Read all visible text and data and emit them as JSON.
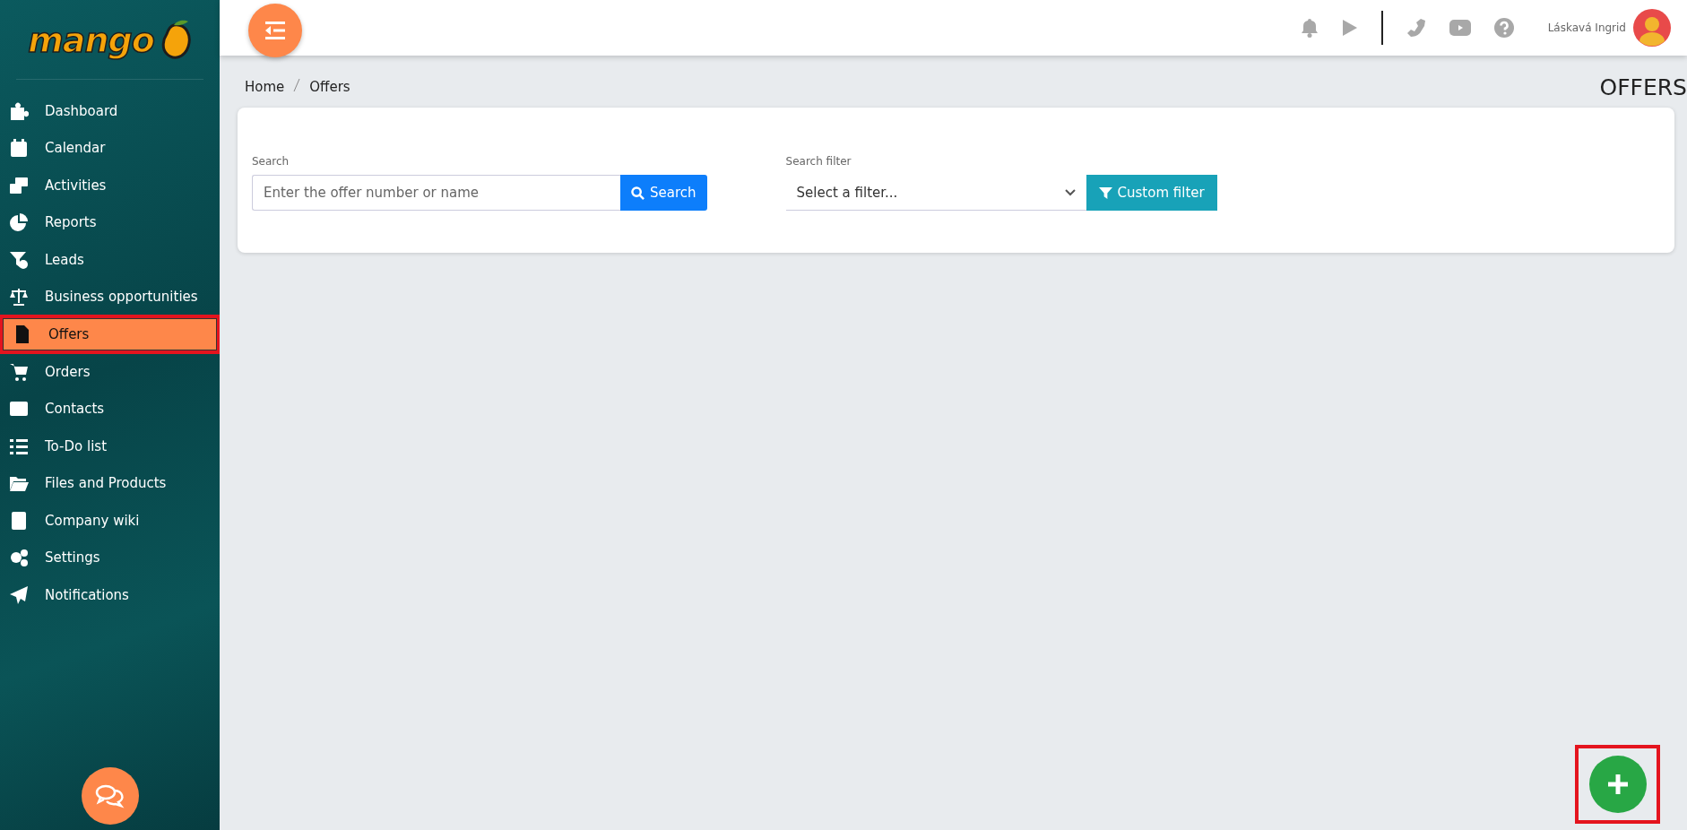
{
  "sidebar": {
    "logo": "mango",
    "items": [
      {
        "label": "Dashboard",
        "selected": false
      },
      {
        "label": "Calendar",
        "selected": false
      },
      {
        "label": "Activities",
        "selected": false
      },
      {
        "label": "Reports",
        "selected": false
      },
      {
        "label": "Leads",
        "selected": false
      },
      {
        "label": "Business opportunities",
        "selected": false
      },
      {
        "label": "Offers",
        "selected": true
      },
      {
        "label": "Orders",
        "selected": false
      },
      {
        "label": "Contacts",
        "selected": false
      },
      {
        "label": "To-Do list",
        "selected": false
      },
      {
        "label": "Files and Products",
        "selected": false
      },
      {
        "label": "Company wiki",
        "selected": false
      },
      {
        "label": "Settings",
        "selected": false
      },
      {
        "label": "Notifications",
        "selected": false
      }
    ]
  },
  "header": {
    "user_name": "Láskavá Ingrid"
  },
  "breadcrumb": [
    "Home",
    "Offers"
  ],
  "page_title": "OFFERS",
  "search": {
    "label": "Search",
    "placeholder": "Enter the offer number or name",
    "button": "Search"
  },
  "filter": {
    "label": "Search filter",
    "value": "Select a filter...",
    "button": "Custom filter"
  }
}
